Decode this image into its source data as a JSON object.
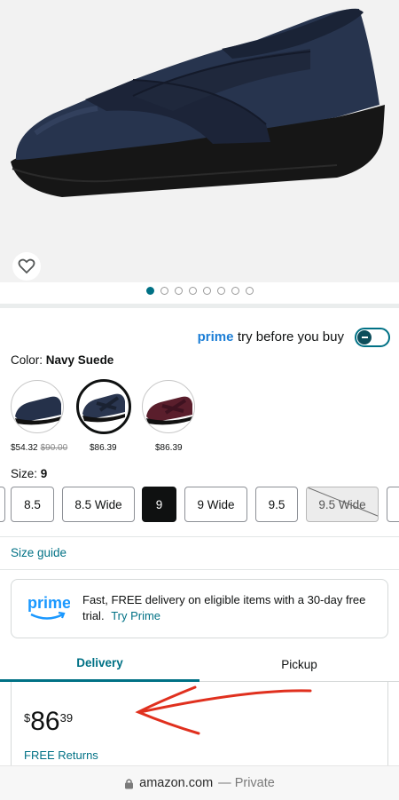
{
  "product": {
    "image_alt": "Navy suede slip-on wedge shoe with crossed elastic straps",
    "carousel": {
      "total": 8,
      "active": 0
    }
  },
  "try_before_buy": {
    "prime": "prime",
    "label": "try before you buy",
    "enabled": false
  },
  "color": {
    "label": "Color:",
    "value": "Navy Suede"
  },
  "swatches": [
    {
      "name": "navy-suede-alt",
      "price": "$54.32",
      "list_price": "$90.00",
      "selected": false
    },
    {
      "name": "navy-suede",
      "price": "$86.39",
      "list_price": "",
      "selected": true
    },
    {
      "name": "burgundy",
      "price": "$86.39",
      "list_price": "",
      "selected": false
    }
  ],
  "size": {
    "label": "Size:",
    "value": "9"
  },
  "sizes": [
    {
      "label": "8.5",
      "state": "available"
    },
    {
      "label": "8.5 Wide",
      "state": "available"
    },
    {
      "label": "9",
      "state": "selected"
    },
    {
      "label": "9 Wide",
      "state": "available"
    },
    {
      "label": "9.5",
      "state": "available"
    },
    {
      "label": "9.5 Wide",
      "state": "unavailable"
    }
  ],
  "size_guide": "Size guide",
  "prime_banner": {
    "logo_text": "prime",
    "message": "Fast, FREE delivery on eligible items with a 30-day free trial.",
    "link": "Try Prime"
  },
  "tabs": [
    {
      "label": "Delivery",
      "active": true
    },
    {
      "label": "Pickup",
      "active": false
    }
  ],
  "price": {
    "symbol": "$",
    "whole": "86",
    "fraction": "39"
  },
  "returns": "FREE Returns",
  "urlbar": {
    "domain": "amazon.com",
    "mode": "— Private"
  },
  "colors": {
    "link": "#007185",
    "annotation_arrow": "#e0301e",
    "prime_blue": "#1a98ff"
  }
}
